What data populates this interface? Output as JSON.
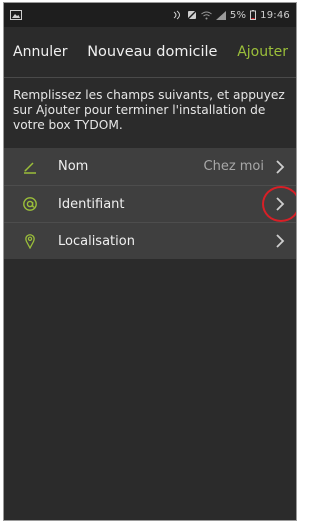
{
  "status_bar": {
    "battery_percent": "5%",
    "time": "19:46",
    "icons": [
      "image-icon",
      "nfc-icon",
      "mute-icon",
      "wifi-icon",
      "signal-icon",
      "battery-icon"
    ]
  },
  "nav": {
    "cancel_label": "Annuler",
    "title": "Nouveau domicile",
    "add_label": "Ajouter"
  },
  "instructions": "Remplissez les champs suivants, et appuyez sur Ajouter pour terminer l'installation de votre box TYDOM.",
  "rows": [
    {
      "icon": "pencil-icon",
      "label": "Nom",
      "value": "Chez moi"
    },
    {
      "icon": "at-sign-icon",
      "label": "Identifiant",
      "value": ""
    },
    {
      "icon": "location-pin-icon",
      "label": "Localisation",
      "value": ""
    }
  ],
  "colors": {
    "accent": "#9bbf3a",
    "background": "#2b2b2b",
    "row_background": "#3f3f3f",
    "highlight": "#d81f26"
  }
}
